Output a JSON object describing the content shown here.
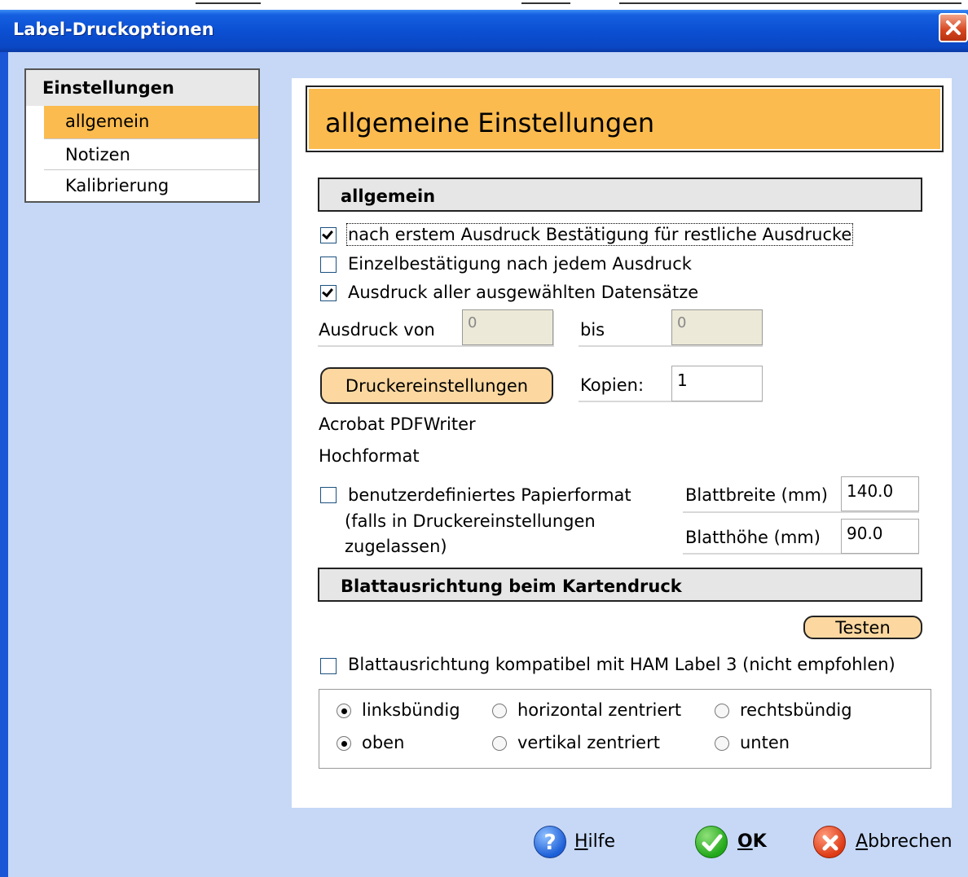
{
  "window": {
    "title": "Label-Druckoptionen"
  },
  "sidebar": {
    "header": "Einstellungen",
    "items": [
      {
        "label": "allgemein",
        "selected": true
      },
      {
        "label": "Notizen",
        "selected": false
      },
      {
        "label": "Kalibrierung",
        "selected": false
      }
    ]
  },
  "main": {
    "heading": "allgemeine Einstellungen",
    "section_general": "allgemein",
    "options": {
      "confirm_after_first": {
        "label": "nach erstem Ausdruck Bestätigung für restliche Ausdrucke",
        "checked": true
      },
      "confirm_each": {
        "label": "Einzelbestätigung nach jedem Ausdruck",
        "checked": false
      },
      "print_all_selected": {
        "label": "Ausdruck aller ausgewählten Datensätze",
        "checked": true
      }
    },
    "range": {
      "from_label": "Ausdruck von",
      "from_value": "0",
      "to_label": "bis",
      "to_value": "0"
    },
    "printer_settings_button": "Druckereinstellungen",
    "copies": {
      "label": "Kopien:",
      "value": "1"
    },
    "printer_name": "Acrobat PDFWriter",
    "orientation": "Hochformat",
    "custom_paper": {
      "label_line1": "benutzerdefiniertes Papierformat",
      "label_line2": "(falls in Druckereinstellungen",
      "label_line3": "zugelassen)",
      "checked": false,
      "width_label": "Blattbreite (mm)",
      "width_value": "140.0",
      "height_label": "Blatthöhe (mm)",
      "height_value": "90.0"
    },
    "section_alignment": "Blattausrichtung beim Kartendruck",
    "test_button": "Testen",
    "ham_compat": {
      "label": "Blattausrichtung kompatibel mit HAM Label 3 (nicht empfohlen)",
      "checked": false
    },
    "horizontal": {
      "options": [
        "linksbündig",
        "horizontal zentriert",
        "rechtsbündig"
      ],
      "selected": "linksbündig"
    },
    "vertical": {
      "options": [
        "oben",
        "vertikal zentriert",
        "unten"
      ],
      "selected": "oben"
    }
  },
  "footer": {
    "help_label": "ilfe",
    "help_mnemonic": "H",
    "ok_label": "K",
    "ok_mnemonic": "O",
    "cancel_label": "bbrechen",
    "cancel_mnemonic": "A"
  },
  "colors": {
    "accent": "#fbbb4f",
    "titlebar": "#0b4fd2",
    "dialog_bg": "#c6d8f6",
    "button_fill": "#fcd8a0"
  },
  "icons": {
    "close": "close-icon",
    "help": "help-icon",
    "ok": "checkmark-icon",
    "cancel": "cancel-icon"
  }
}
